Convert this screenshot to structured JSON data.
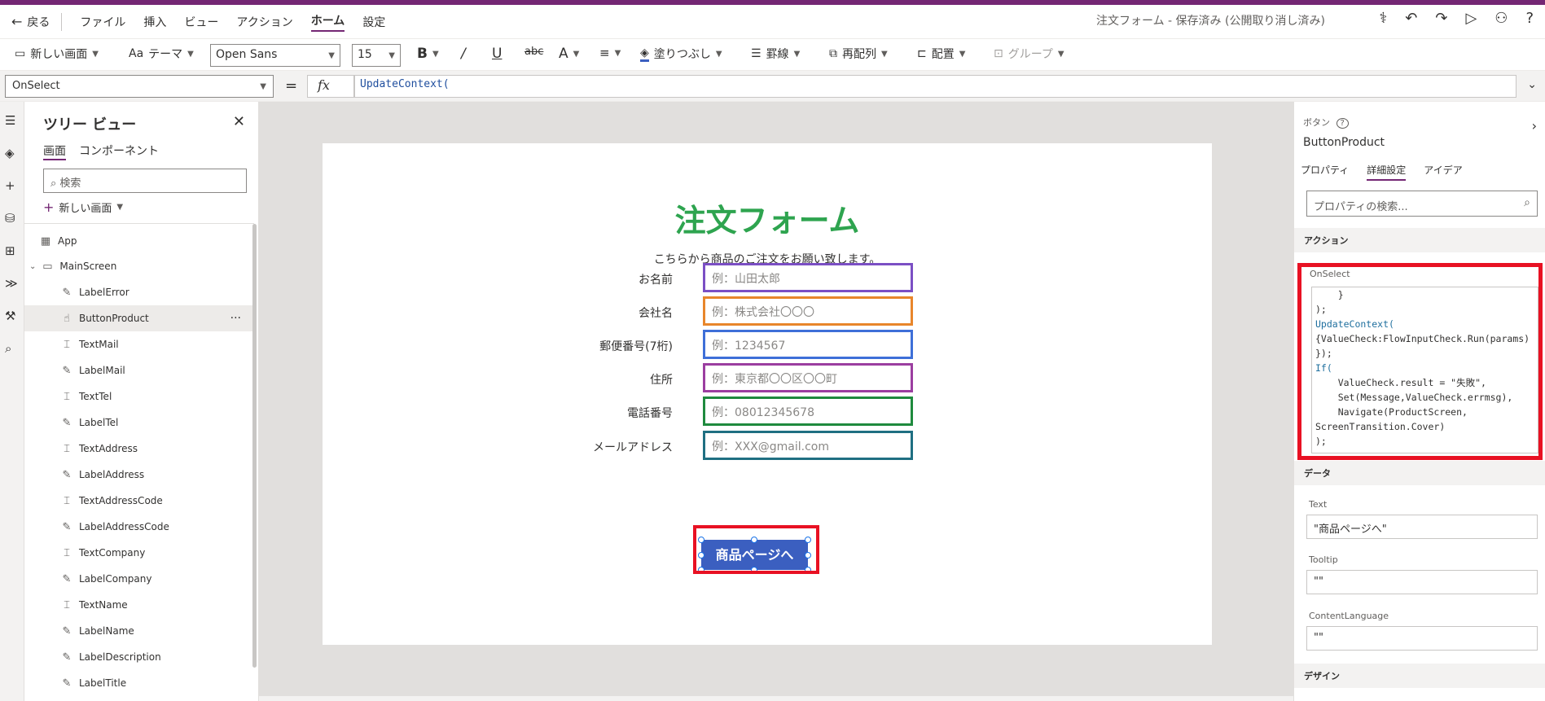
{
  "menubar": {
    "back": "戻る",
    "items": [
      "ファイル",
      "挿入",
      "ビュー",
      "アクション",
      "ホーム",
      "設定"
    ],
    "doc_title": "注文フォーム - 保存済み (公開取り消し済み)"
  },
  "toolbar": {
    "new_screen": "新しい画面",
    "theme": "テーマ",
    "font": "Open Sans",
    "font_size": "15",
    "fill": "塗りつぶし",
    "border": "罫線",
    "reorder": "再配列",
    "align": "配置",
    "group": "グループ"
  },
  "formula_bar": {
    "property": "OnSelect",
    "equals": "=",
    "fx": "fx",
    "formula": "UpdateContext("
  },
  "tree": {
    "title": "ツリー ビュー",
    "tabs": [
      "画面",
      "コンポーネント"
    ],
    "search_placeholder": "検索",
    "new_screen": "新しい画面",
    "app": "App",
    "main_screen": "MainScreen",
    "items": [
      "LabelError",
      "ButtonProduct",
      "TextMail",
      "LabelMail",
      "TextTel",
      "LabelTel",
      "TextAddress",
      "LabelAddress",
      "TextAddressCode",
      "LabelAddressCode",
      "TextCompany",
      "LabelCompany",
      "TextName",
      "LabelName",
      "LabelDescription",
      "LabelTitle"
    ],
    "more": "···"
  },
  "form": {
    "title": "注文フォーム",
    "description": "こちらから商品のご注文をお願い致します。",
    "fields": [
      {
        "label": "お名前",
        "placeholder": "例：山田太郎",
        "color": "#7b4fc4"
      },
      {
        "label": "会社名",
        "placeholder": "例：株式会社〇〇〇",
        "color": "#e8862b"
      },
      {
        "label": "郵便番号(7桁)",
        "placeholder": "例：1234567",
        "color": "#3e6fd8"
      },
      {
        "label": "住所",
        "placeholder": "例：東京都〇〇区〇〇町",
        "color": "#9b3ea0"
      },
      {
        "label": "電話番号",
        "placeholder": "例：08012345678",
        "color": "#1f8a3e"
      },
      {
        "label": "メールアドレス",
        "placeholder": "例：XXX@gmail.com",
        "color": "#1f6f82"
      }
    ],
    "button": "商品ページへ"
  },
  "props": {
    "type": "ボタン",
    "name": "ButtonProduct",
    "tabs": [
      "プロパティ",
      "詳細設定",
      "アイデア"
    ],
    "search_placeholder": "プロパティの検索...",
    "section_action": "アクション",
    "onselect_label": "OnSelect",
    "code_lines": [
      "    }",
      ");",
      "UpdateContext(",
      "{ValueCheck:FlowInputCheck.Run(params)",
      "});",
      "If(",
      "    ValueCheck.result = \"失敗\",",
      "    Set(Message,ValueCheck.errmsg),",
      "    Navigate(ProductScreen,",
      "ScreenTransition.Cover)",
      ");"
    ],
    "section_data": "データ",
    "text_label": "Text",
    "text_value": "\"商品ページへ\"",
    "tooltip_label": "Tooltip",
    "tooltip_value": "\"\"",
    "content_lang_label": "ContentLanguage",
    "content_lang_value": "\"\"",
    "section_design": "デザイン"
  },
  "colors": {
    "accent": "#742774",
    "title_green": "#2ea44f",
    "button_blue": "#3b5fc0",
    "highlight_red": "#e81123"
  }
}
